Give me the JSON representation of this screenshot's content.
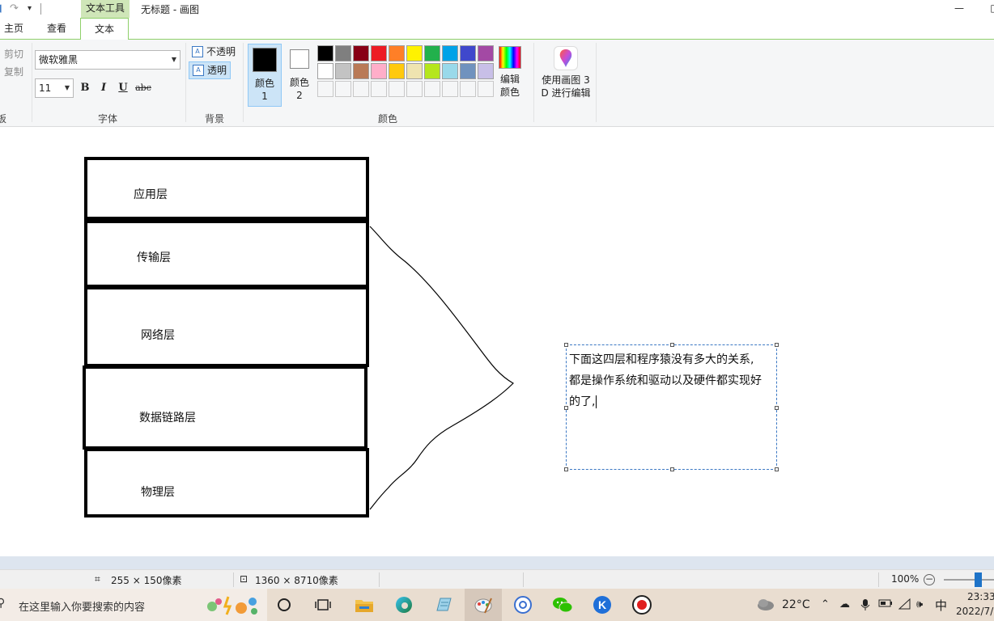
{
  "titlebar": {
    "context_tab": "文本工具",
    "title": "无标题 - 画图",
    "minimize": "—",
    "maximize": "□"
  },
  "tabs": {
    "home": "主页",
    "view": "查看",
    "text": "文本"
  },
  "ribbon": {
    "clipboard": {
      "cut": "剪切",
      "copy": "复制",
      "label_fragment": "板"
    },
    "font": {
      "family": "微软雅黑",
      "size": "11",
      "bold": "B",
      "italic": "I",
      "underline": "U",
      "strike": "abc",
      "group_label": "字体"
    },
    "background": {
      "opaque": "不透明",
      "transparent": "透明",
      "group_label": "背景",
      "icon_glyph": "A"
    },
    "colors": {
      "color1_label": "颜色 1",
      "color2_label": "颜色 2",
      "color1_value": "#000000",
      "color2_value": "#ffffff",
      "edit_colors": "编辑颜色",
      "group_label": "颜色",
      "palette": [
        "#000000",
        "#7f7f7f",
        "#880015",
        "#ed1c24",
        "#ff7f27",
        "#fff200",
        "#22b14c",
        "#00a2e8",
        "#3f48cc",
        "#a349a4",
        "#ffffff",
        "#c3c3c3",
        "#b97a57",
        "#ffaec9",
        "#ffc90e",
        "#efe4b0",
        "#b5e61d",
        "#99d9ea",
        "#7092be",
        "#c8bfe7",
        "#f5f6f7",
        "#f5f6f7",
        "#f5f6f7",
        "#f5f6f7",
        "#f5f6f7",
        "#f5f6f7",
        "#f5f6f7",
        "#f5f6f7",
        "#f5f6f7",
        "#f5f6f7"
      ]
    },
    "paint3d": {
      "label_line1": "使用画图 3",
      "label_line2": "D 进行编辑"
    }
  },
  "canvas": {
    "layers": [
      "应用层",
      "传输层",
      "网络层",
      "数据链路层",
      "物理层"
    ],
    "textbox_lines": [
      "下面这四层和程序猿没有多大的关系,",
      "都是操作系统和驱动以及硬件都实现好",
      "的了,"
    ]
  },
  "status": {
    "selection_size": "255 × 150像素",
    "canvas_size": "1360 × 8710像素",
    "zoom": "100%",
    "zoom_level_fraction": 0.7
  },
  "taskbar": {
    "search_placeholder": "在这里输入你要搜索的内容",
    "temperature": "22°C",
    "ime": "中",
    "time": "23:33",
    "date": "2022/7/"
  }
}
